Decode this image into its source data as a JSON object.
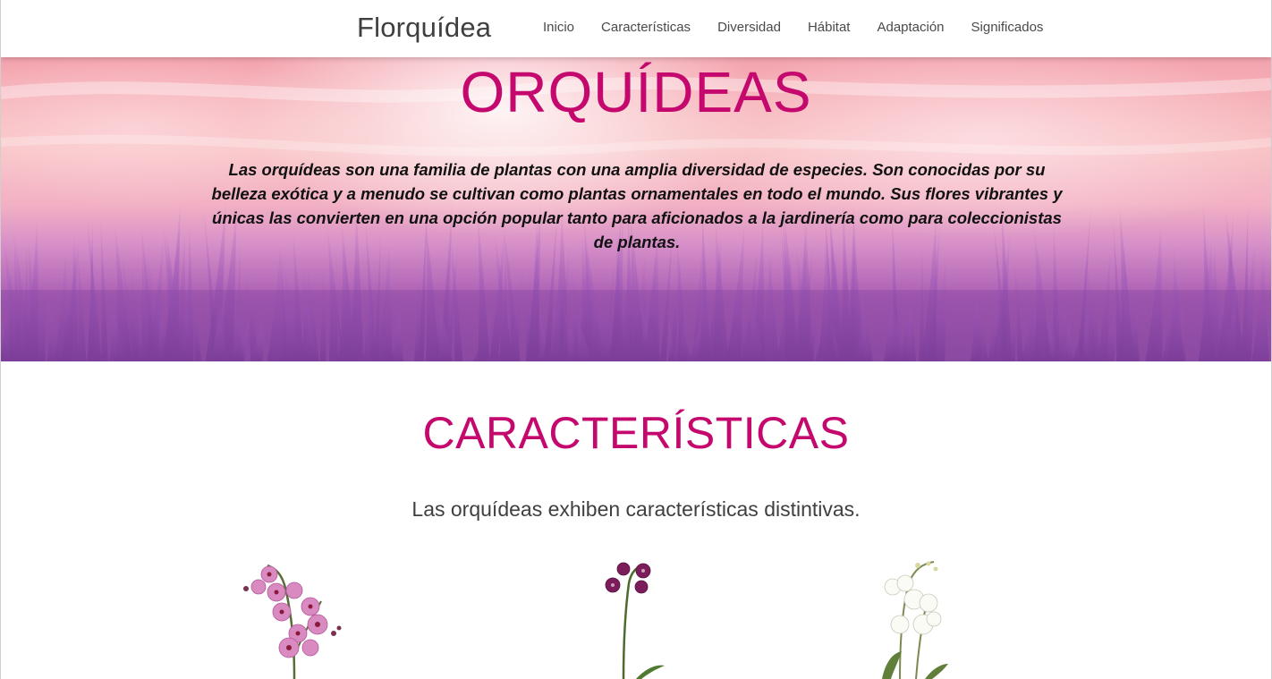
{
  "navbar": {
    "brand": "Florquídea",
    "links": [
      "Inicio",
      "Características",
      "Diversidad",
      "Hábitat",
      "Adaptación",
      "Significados"
    ]
  },
  "hero": {
    "title": "ORQUÍDEAS",
    "text": "Las orquídeas son una familia de plantas con una amplia diversidad de especies. Son conocidas por su belleza exótica y a menudo se cultivan como plantas ornamentales en todo el mundo. Sus flores vibrantes y únicas las convierten en una opción popular tanto para aficionados a la jardinería como para coleccionistas de plantas."
  },
  "caracteristicas": {
    "title": "CARACTERÍSTICAS",
    "subtitle": "Las orquídeas exhiben características distintivas.",
    "images": [
      "pink-orchid-image",
      "purple-orchid-image",
      "white-orchid-image"
    ]
  },
  "colors": {
    "accent": "#c4086e",
    "nav_text": "#4a4a4a",
    "brand_text": "#3f3f3f"
  }
}
